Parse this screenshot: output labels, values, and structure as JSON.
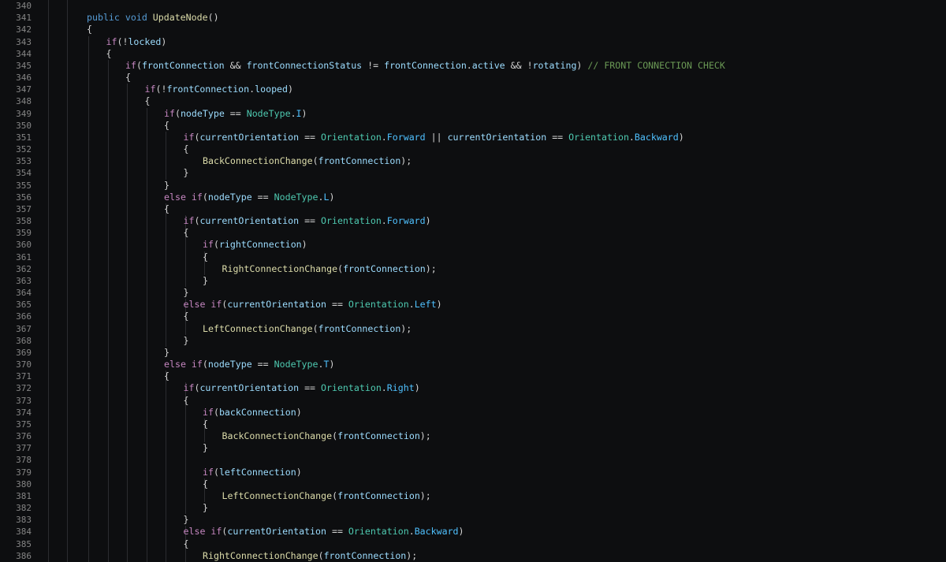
{
  "editor": {
    "colors": {
      "background": "#0d0e10",
      "line_number": "#858585",
      "text": "#d4d4d4",
      "keyword": "#569cd6",
      "control": "#c586c0",
      "function": "#dcdcaa",
      "variable": "#9cdcfe",
      "type": "#4ec9b0",
      "member": "#4fc1ff",
      "comment": "#6a9955"
    },
    "lines": [
      {
        "num": "340",
        "indent": 0,
        "tokens": []
      },
      {
        "num": "341",
        "indent": 0,
        "tokens": [
          [
            "kw",
            "public"
          ],
          [
            "op",
            " "
          ],
          [
            "kw",
            "void"
          ],
          [
            "op",
            " "
          ],
          [
            "fn",
            "UpdateNode"
          ],
          [
            "op",
            "()"
          ]
        ]
      },
      {
        "num": "342",
        "indent": 0,
        "tokens": [
          [
            "op",
            "{"
          ]
        ]
      },
      {
        "num": "343",
        "indent": 1,
        "tokens": [
          [
            "ctl",
            "if"
          ],
          [
            "op",
            "(!"
          ],
          [
            "var",
            "locked"
          ],
          [
            "op",
            ")"
          ]
        ]
      },
      {
        "num": "344",
        "indent": 1,
        "tokens": [
          [
            "op",
            "{"
          ]
        ]
      },
      {
        "num": "345",
        "indent": 2,
        "tokens": [
          [
            "ctl",
            "if"
          ],
          [
            "op",
            "("
          ],
          [
            "var",
            "frontConnection"
          ],
          [
            "op",
            " && "
          ],
          [
            "var",
            "frontConnectionStatus"
          ],
          [
            "op",
            " != "
          ],
          [
            "var",
            "frontConnection"
          ],
          [
            "op",
            "."
          ],
          [
            "var",
            "active"
          ],
          [
            "op",
            " && !"
          ],
          [
            "var",
            "rotating"
          ],
          [
            "op",
            ") "
          ],
          [
            "cm",
            "// FRONT CONNECTION CHECK"
          ]
        ]
      },
      {
        "num": "346",
        "indent": 2,
        "tokens": [
          [
            "op",
            "{"
          ]
        ]
      },
      {
        "num": "347",
        "indent": 3,
        "tokens": [
          [
            "ctl",
            "if"
          ],
          [
            "op",
            "(!"
          ],
          [
            "var",
            "frontConnection"
          ],
          [
            "op",
            "."
          ],
          [
            "var",
            "looped"
          ],
          [
            "op",
            ")"
          ]
        ]
      },
      {
        "num": "348",
        "indent": 3,
        "tokens": [
          [
            "op",
            "{"
          ]
        ]
      },
      {
        "num": "349",
        "indent": 4,
        "tokens": [
          [
            "ctl",
            "if"
          ],
          [
            "op",
            "("
          ],
          [
            "var",
            "nodeType"
          ],
          [
            "op",
            " == "
          ],
          [
            "type",
            "NodeType"
          ],
          [
            "op",
            "."
          ],
          [
            "mem",
            "I"
          ],
          [
            "op",
            ")"
          ]
        ]
      },
      {
        "num": "350",
        "indent": 4,
        "tokens": [
          [
            "op",
            "{"
          ]
        ]
      },
      {
        "num": "351",
        "indent": 5,
        "tokens": [
          [
            "ctl",
            "if"
          ],
          [
            "op",
            "("
          ],
          [
            "var",
            "currentOrientation"
          ],
          [
            "op",
            " == "
          ],
          [
            "type",
            "Orientation"
          ],
          [
            "op",
            "."
          ],
          [
            "mem",
            "Forward"
          ],
          [
            "op",
            " || "
          ],
          [
            "var",
            "currentOrientation"
          ],
          [
            "op",
            " == "
          ],
          [
            "type",
            "Orientation"
          ],
          [
            "op",
            "."
          ],
          [
            "mem",
            "Backward"
          ],
          [
            "op",
            ")"
          ]
        ]
      },
      {
        "num": "352",
        "indent": 5,
        "tokens": [
          [
            "op",
            "{"
          ]
        ]
      },
      {
        "num": "353",
        "indent": 6,
        "tokens": [
          [
            "fn",
            "BackConnectionChange"
          ],
          [
            "op",
            "("
          ],
          [
            "var",
            "frontConnection"
          ],
          [
            "op",
            ");"
          ]
        ]
      },
      {
        "num": "354",
        "indent": 5,
        "tokens": [
          [
            "op",
            "}"
          ]
        ]
      },
      {
        "num": "355",
        "indent": 4,
        "tokens": [
          [
            "op",
            "}"
          ]
        ]
      },
      {
        "num": "356",
        "indent": 4,
        "tokens": [
          [
            "ctl",
            "else"
          ],
          [
            "op",
            " "
          ],
          [
            "ctl",
            "if"
          ],
          [
            "op",
            "("
          ],
          [
            "var",
            "nodeType"
          ],
          [
            "op",
            " == "
          ],
          [
            "type",
            "NodeType"
          ],
          [
            "op",
            "."
          ],
          [
            "mem",
            "L"
          ],
          [
            "op",
            ")"
          ]
        ]
      },
      {
        "num": "357",
        "indent": 4,
        "tokens": [
          [
            "op",
            "{"
          ]
        ]
      },
      {
        "num": "358",
        "indent": 5,
        "tokens": [
          [
            "ctl",
            "if"
          ],
          [
            "op",
            "("
          ],
          [
            "var",
            "currentOrientation"
          ],
          [
            "op",
            " == "
          ],
          [
            "type",
            "Orientation"
          ],
          [
            "op",
            "."
          ],
          [
            "mem",
            "Forward"
          ],
          [
            "op",
            ")"
          ]
        ]
      },
      {
        "num": "359",
        "indent": 5,
        "tokens": [
          [
            "op",
            "{"
          ]
        ]
      },
      {
        "num": "360",
        "indent": 6,
        "tokens": [
          [
            "ctl",
            "if"
          ],
          [
            "op",
            "("
          ],
          [
            "var",
            "rightConnection"
          ],
          [
            "op",
            ")"
          ]
        ]
      },
      {
        "num": "361",
        "indent": 6,
        "tokens": [
          [
            "op",
            "{"
          ]
        ]
      },
      {
        "num": "362",
        "indent": 7,
        "tokens": [
          [
            "fn",
            "RightConnectionChange"
          ],
          [
            "op",
            "("
          ],
          [
            "var",
            "frontConnection"
          ],
          [
            "op",
            ");"
          ]
        ]
      },
      {
        "num": "363",
        "indent": 6,
        "tokens": [
          [
            "op",
            "}"
          ]
        ]
      },
      {
        "num": "364",
        "indent": 5,
        "tokens": [
          [
            "op",
            "}"
          ]
        ]
      },
      {
        "num": "365",
        "indent": 5,
        "tokens": [
          [
            "ctl",
            "else"
          ],
          [
            "op",
            " "
          ],
          [
            "ctl",
            "if"
          ],
          [
            "op",
            "("
          ],
          [
            "var",
            "currentOrientation"
          ],
          [
            "op",
            " == "
          ],
          [
            "type",
            "Orientation"
          ],
          [
            "op",
            "."
          ],
          [
            "mem",
            "Left"
          ],
          [
            "op",
            ")"
          ]
        ]
      },
      {
        "num": "366",
        "indent": 5,
        "tokens": [
          [
            "op",
            "{"
          ]
        ]
      },
      {
        "num": "367",
        "indent": 6,
        "tokens": [
          [
            "fn",
            "LeftConnectionChange"
          ],
          [
            "op",
            "("
          ],
          [
            "var",
            "frontConnection"
          ],
          [
            "op",
            ");"
          ]
        ]
      },
      {
        "num": "368",
        "indent": 5,
        "tokens": [
          [
            "op",
            "}"
          ]
        ]
      },
      {
        "num": "369",
        "indent": 4,
        "tokens": [
          [
            "op",
            "}"
          ]
        ]
      },
      {
        "num": "370",
        "indent": 4,
        "tokens": [
          [
            "ctl",
            "else"
          ],
          [
            "op",
            " "
          ],
          [
            "ctl",
            "if"
          ],
          [
            "op",
            "("
          ],
          [
            "var",
            "nodeType"
          ],
          [
            "op",
            " == "
          ],
          [
            "type",
            "NodeType"
          ],
          [
            "op",
            "."
          ],
          [
            "mem",
            "T"
          ],
          [
            "op",
            ")"
          ]
        ]
      },
      {
        "num": "371",
        "indent": 4,
        "tokens": [
          [
            "op",
            "{"
          ]
        ]
      },
      {
        "num": "372",
        "indent": 5,
        "tokens": [
          [
            "ctl",
            "if"
          ],
          [
            "op",
            "("
          ],
          [
            "var",
            "currentOrientation"
          ],
          [
            "op",
            " == "
          ],
          [
            "type",
            "Orientation"
          ],
          [
            "op",
            "."
          ],
          [
            "mem",
            "Right"
          ],
          [
            "op",
            ")"
          ]
        ]
      },
      {
        "num": "373",
        "indent": 5,
        "tokens": [
          [
            "op",
            "{"
          ]
        ]
      },
      {
        "num": "374",
        "indent": 6,
        "tokens": [
          [
            "ctl",
            "if"
          ],
          [
            "op",
            "("
          ],
          [
            "var",
            "backConnection"
          ],
          [
            "op",
            ")"
          ]
        ]
      },
      {
        "num": "375",
        "indent": 6,
        "tokens": [
          [
            "op",
            "{"
          ]
        ]
      },
      {
        "num": "376",
        "indent": 7,
        "tokens": [
          [
            "fn",
            "BackConnectionChange"
          ],
          [
            "op",
            "("
          ],
          [
            "var",
            "frontConnection"
          ],
          [
            "op",
            ");"
          ]
        ]
      },
      {
        "num": "377",
        "indent": 6,
        "tokens": [
          [
            "op",
            "}"
          ]
        ]
      },
      {
        "num": "378",
        "indent": 0,
        "tokens": []
      },
      {
        "num": "379",
        "indent": 6,
        "tokens": [
          [
            "ctl",
            "if"
          ],
          [
            "op",
            "("
          ],
          [
            "var",
            "leftConnection"
          ],
          [
            "op",
            ")"
          ]
        ]
      },
      {
        "num": "380",
        "indent": 6,
        "tokens": [
          [
            "op",
            "{"
          ]
        ]
      },
      {
        "num": "381",
        "indent": 7,
        "tokens": [
          [
            "fn",
            "LeftConnectionChange"
          ],
          [
            "op",
            "("
          ],
          [
            "var",
            "frontConnection"
          ],
          [
            "op",
            ");"
          ]
        ]
      },
      {
        "num": "382",
        "indent": 6,
        "tokens": [
          [
            "op",
            "}"
          ]
        ]
      },
      {
        "num": "383",
        "indent": 5,
        "tokens": [
          [
            "op",
            "}"
          ]
        ]
      },
      {
        "num": "384",
        "indent": 5,
        "tokens": [
          [
            "ctl",
            "else"
          ],
          [
            "op",
            " "
          ],
          [
            "ctl",
            "if"
          ],
          [
            "op",
            "("
          ],
          [
            "var",
            "currentOrientation"
          ],
          [
            "op",
            " == "
          ],
          [
            "type",
            "Orientation"
          ],
          [
            "op",
            "."
          ],
          [
            "mem",
            "Backward"
          ],
          [
            "op",
            ")"
          ]
        ]
      },
      {
        "num": "385",
        "indent": 5,
        "tokens": [
          [
            "op",
            "{"
          ]
        ]
      },
      {
        "num": "386",
        "indent": 6,
        "tokens": [
          [
            "fn",
            "RightConnectionChange"
          ],
          [
            "op",
            "("
          ],
          [
            "var",
            "frontConnection"
          ],
          [
            "op",
            ");"
          ]
        ]
      }
    ]
  }
}
